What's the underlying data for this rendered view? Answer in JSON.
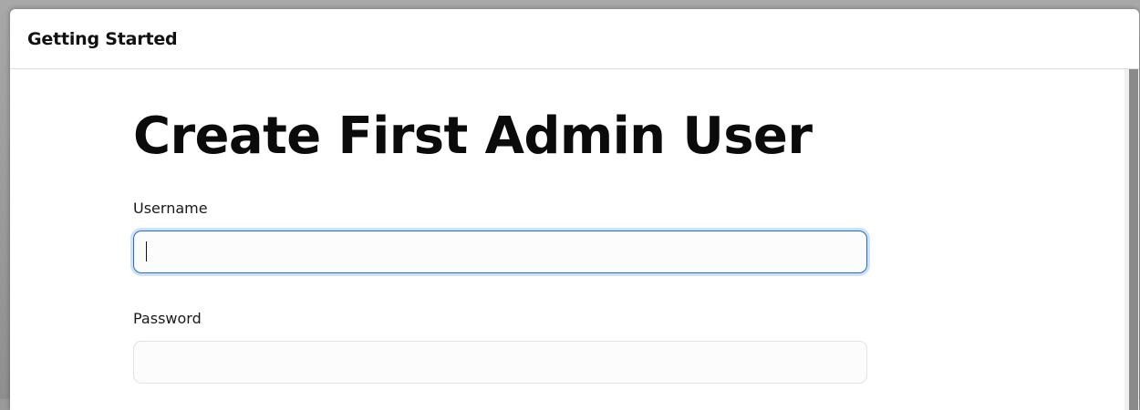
{
  "dialog": {
    "title": "Getting Started"
  },
  "form": {
    "heading": "Create First Admin User",
    "username": {
      "label": "Username",
      "value": "",
      "placeholder": ""
    },
    "password": {
      "label": "Password",
      "value": "",
      "placeholder": ""
    }
  },
  "colors": {
    "focus_border": "#1f6fd1",
    "focus_ring": "#cfe0fb",
    "input_border": "#e2e2e2",
    "scroll_thumb": "#8a8a8a"
  }
}
